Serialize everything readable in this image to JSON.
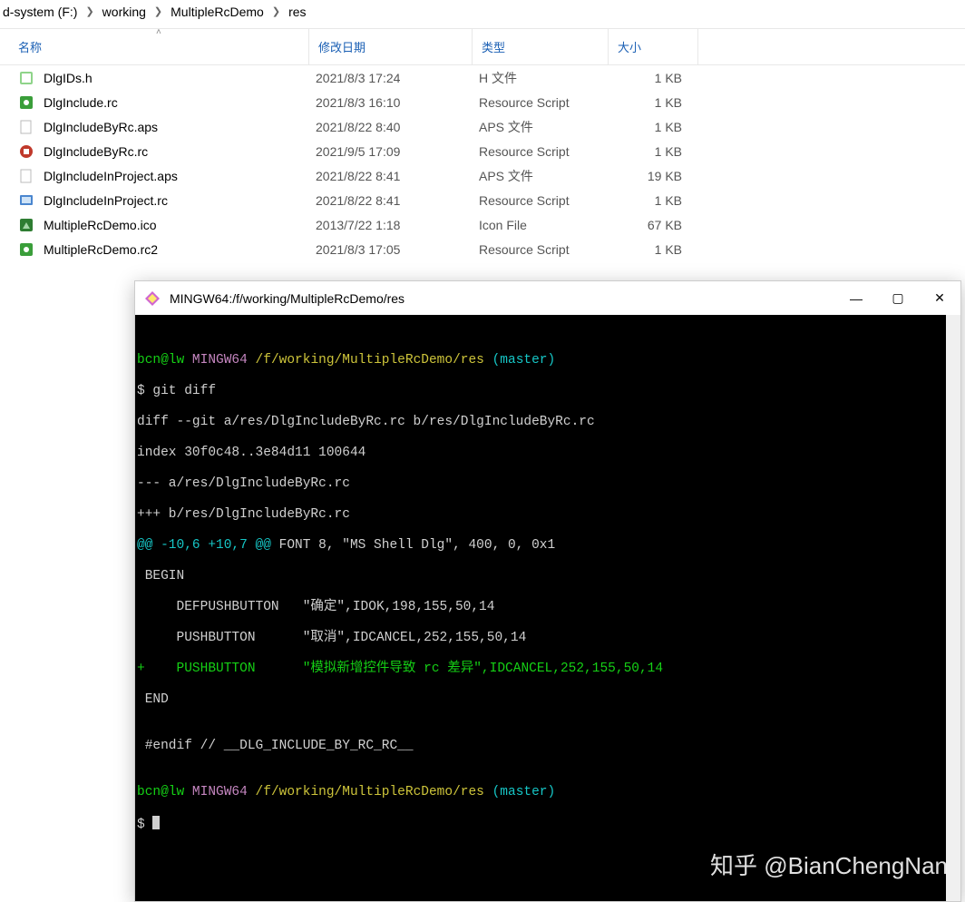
{
  "breadcrumb": {
    "seg0": "d-system (F:)",
    "seg1": "working",
    "seg2": "MultipleRcDemo",
    "seg3": "res"
  },
  "columns": {
    "name": "名称",
    "date": "修改日期",
    "type": "类型",
    "size": "大小"
  },
  "files": [
    {
      "name": "DlgIDs.h",
      "date": "2021/8/3 17:24",
      "type": "H 文件",
      "size": "1 KB",
      "icon": "h"
    },
    {
      "name": "DlgInclude.rc",
      "date": "2021/8/3 16:10",
      "type": "Resource Script",
      "size": "1 KB",
      "icon": "rc"
    },
    {
      "name": "DlgIncludeByRc.aps",
      "date": "2021/8/22 8:40",
      "type": "APS 文件",
      "size": "1 KB",
      "icon": "aps"
    },
    {
      "name": "DlgIncludeByRc.rc",
      "date": "2021/9/5 17:09",
      "type": "Resource Script",
      "size": "1 KB",
      "icon": "rc2"
    },
    {
      "name": "DlgIncludeInProject.aps",
      "date": "2021/8/22 8:41",
      "type": "APS 文件",
      "size": "19 KB",
      "icon": "aps"
    },
    {
      "name": "DlgIncludeInProject.rc",
      "date": "2021/8/22 8:41",
      "type": "Resource Script",
      "size": "1 KB",
      "icon": "rc3"
    },
    {
      "name": "MultipleRcDemo.ico",
      "date": "2013/7/22 1:18",
      "type": "Icon File",
      "size": "67 KB",
      "icon": "ico"
    },
    {
      "name": "MultipleRcDemo.rc2",
      "date": "2021/8/3 17:05",
      "type": "Resource Script",
      "size": "1 KB",
      "icon": "rc"
    }
  ],
  "terminal": {
    "title": "MINGW64:/f/working/MultipleRcDemo/res",
    "prompt_user": "bcn@lw",
    "prompt_host": "MINGW64",
    "prompt_path": "/f/working/MultipleRcDemo/res",
    "prompt_branch": "(master)",
    "cmd": "$ git diff",
    "l_diffhdr": "diff --git a/res/DlgIncludeByRc.rc b/res/DlgIncludeByRc.rc",
    "l_index": "index 30f0c48..3e84d11 100644",
    "l_minus": "--- a/res/DlgIncludeByRc.rc",
    "l_plus": "+++ b/res/DlgIncludeByRc.rc",
    "l_hunk": "@@ -10,6 +10,7 @@",
    "l_hunk_tail": " FONT 8, \"MS Shell Dlg\", 400, 0, 0x1",
    "l_begin": " BEGIN",
    "l_btn1": "     DEFPUSHBUTTON   \"确定\",IDOK,198,155,50,14",
    "l_btn2": "     PUSHBUTTON      \"取消\",IDCANCEL,252,155,50,14",
    "l_add": "+    PUSHBUTTON      \"模拟新增控件导致 rc 差异\",IDCANCEL,252,155,50,14",
    "l_end": " END",
    "l_blank": "",
    "l_endif": " #endif // __DLG_INCLUDE_BY_RC_RC__",
    "prompt2_dollar": "$ "
  },
  "watermark": "知乎 @BianChengNan"
}
